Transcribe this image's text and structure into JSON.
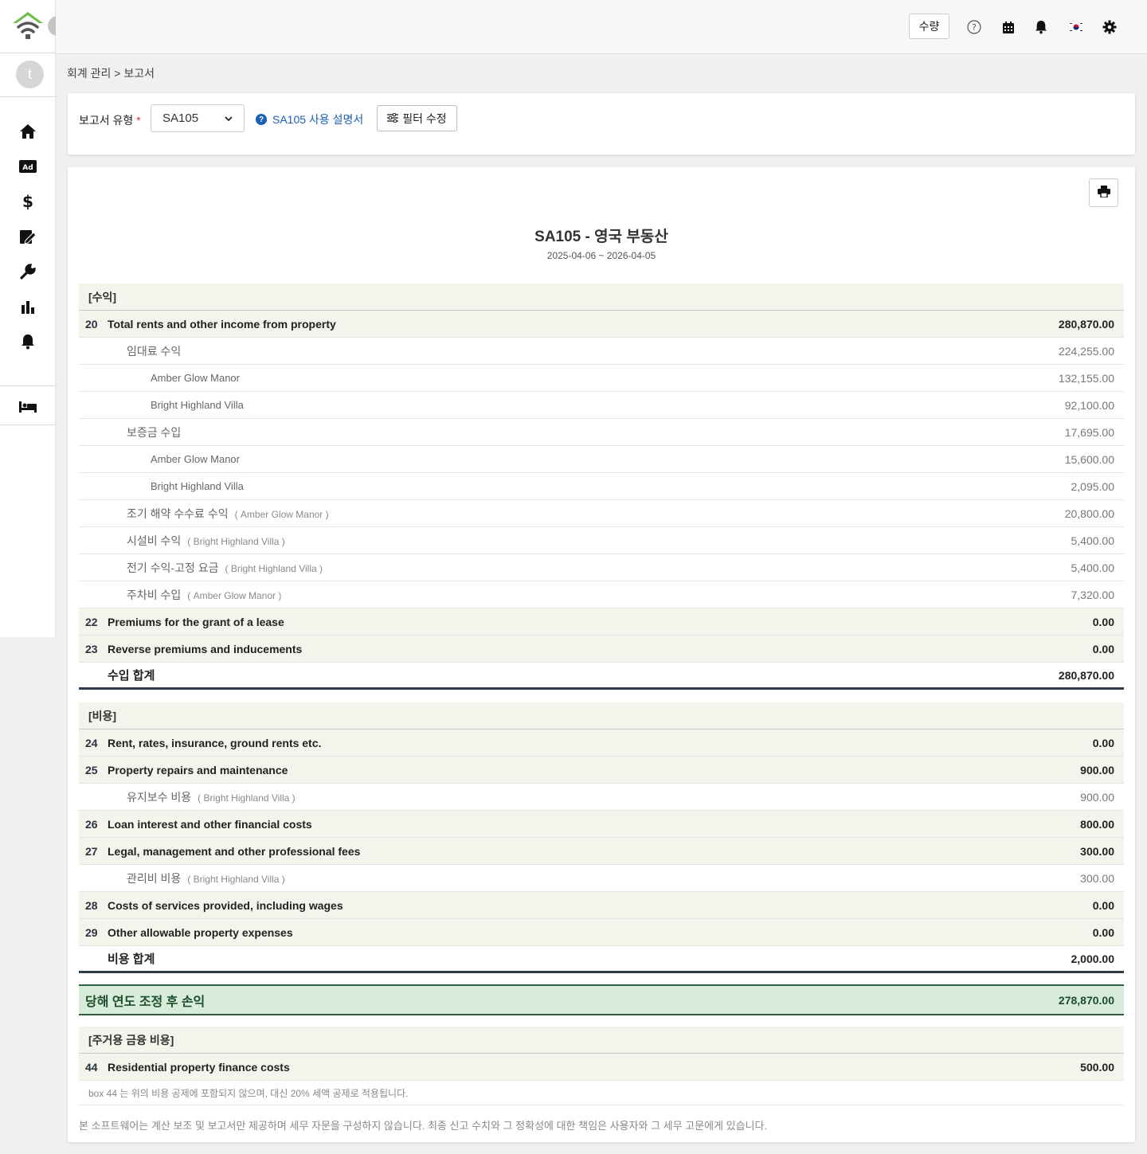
{
  "sidebar": {
    "avatar_initial": "t",
    "nav": [
      "home-icon",
      "ad-icon",
      "dollar-icon",
      "edit-document-icon",
      "wrench-icon",
      "bar-chart-icon",
      "bell-icon",
      "bed-icon"
    ]
  },
  "header": {
    "qty_label": "수량",
    "icons": [
      "help-icon",
      "calendar-icon",
      "bell-icon",
      "korea-flag-icon",
      "gear-icon"
    ]
  },
  "breadcrumb": "회계 관리 > 보고서",
  "filter": {
    "type_label": "보고서 유형",
    "required_mark": "*",
    "selected": "SA105",
    "manual_link": "SA105 사용 설명서",
    "edit_filter": "필터 수정"
  },
  "report": {
    "title": "SA105 - 영국 부동산",
    "period": "2025-04-06  ~  2026-04-05",
    "income_section": "[수익]",
    "income_rows": [
      {
        "kind": "main",
        "num": "20",
        "label": "Total rents and other income from property",
        "amount": "280,870.00"
      },
      {
        "kind": "sub",
        "label": "임대료 수익",
        "amount": "224,255.00"
      },
      {
        "kind": "prop",
        "label": "Amber Glow Manor",
        "amount": "132,155.00"
      },
      {
        "kind": "prop",
        "label": "Bright Highland Villa",
        "amount": "92,100.00"
      },
      {
        "kind": "sub",
        "label": "보증금 수입",
        "amount": "17,695.00"
      },
      {
        "kind": "prop",
        "label": "Amber Glow Manor",
        "amount": "15,600.00"
      },
      {
        "kind": "prop",
        "label": "Bright Highland Villa",
        "amount": "2,095.00"
      },
      {
        "kind": "sub",
        "label": "조기 해약 수수료 수익",
        "tag": "( Amber Glow Manor )",
        "amount": "20,800.00"
      },
      {
        "kind": "sub",
        "label": "시설비 수익",
        "tag": "( Bright Highland Villa )",
        "amount": "5,400.00"
      },
      {
        "kind": "sub",
        "label": "전기 수익-고정 요금",
        "tag": "( Bright Highland Villa )",
        "amount": "5,400.00"
      },
      {
        "kind": "sub",
        "label": "주차비 수입",
        "tag": "( Amber Glow Manor )",
        "amount": "7,320.00"
      },
      {
        "kind": "main",
        "num": "22",
        "label": "Premiums for the grant of a lease",
        "amount": "0.00"
      },
      {
        "kind": "main",
        "num": "23",
        "label": "Reverse premiums and inducements",
        "amount": "0.00"
      }
    ],
    "income_total_label": "수입 합계",
    "income_total": "280,870.00",
    "expense_section": "[비용]",
    "expense_rows": [
      {
        "kind": "main",
        "num": "24",
        "label": "Rent, rates, insurance, ground rents etc.",
        "amount": "0.00"
      },
      {
        "kind": "main",
        "num": "25",
        "label": "Property repairs and maintenance",
        "amount": "900.00"
      },
      {
        "kind": "sub",
        "label": "유지보수 비용",
        "tag": "( Bright Highland Villa )",
        "amount": "900.00"
      },
      {
        "kind": "main",
        "num": "26",
        "label": "Loan interest and other financial costs",
        "amount": "800.00"
      },
      {
        "kind": "main",
        "num": "27",
        "label": "Legal, management and other professional fees",
        "amount": "300.00"
      },
      {
        "kind": "sub",
        "label": "관리비 비용",
        "tag": "( Bright Highland Villa )",
        "amount": "300.00"
      },
      {
        "kind": "main",
        "num": "28",
        "label": "Costs of services provided, including wages",
        "amount": "0.00"
      },
      {
        "kind": "main",
        "num": "29",
        "label": "Other allowable property expenses",
        "amount": "0.00"
      }
    ],
    "expense_total_label": "비용 합계",
    "expense_total": "2,000.00",
    "net_label": "당해 연도 조정 후 손익",
    "net_amount": "278,870.00",
    "finance_section": "[주거용 금융 비용]",
    "finance_row": {
      "num": "44",
      "label": "Residential property finance costs",
      "amount": "500.00"
    },
    "finance_note": "box 44 는 위의 비용 공제에 포함되지 않으며, 대신 20% 세액 공제로 적용됩니다.",
    "disclaimer": "본 소프트웨어는 계산 보조 및 보고서만 제공하며 세무 자문을 구성하지 않습니다. 최종 신고 수치와 그 정확성에 대한 책임은 사용자와 그 세무 고문에게 있습니다."
  }
}
